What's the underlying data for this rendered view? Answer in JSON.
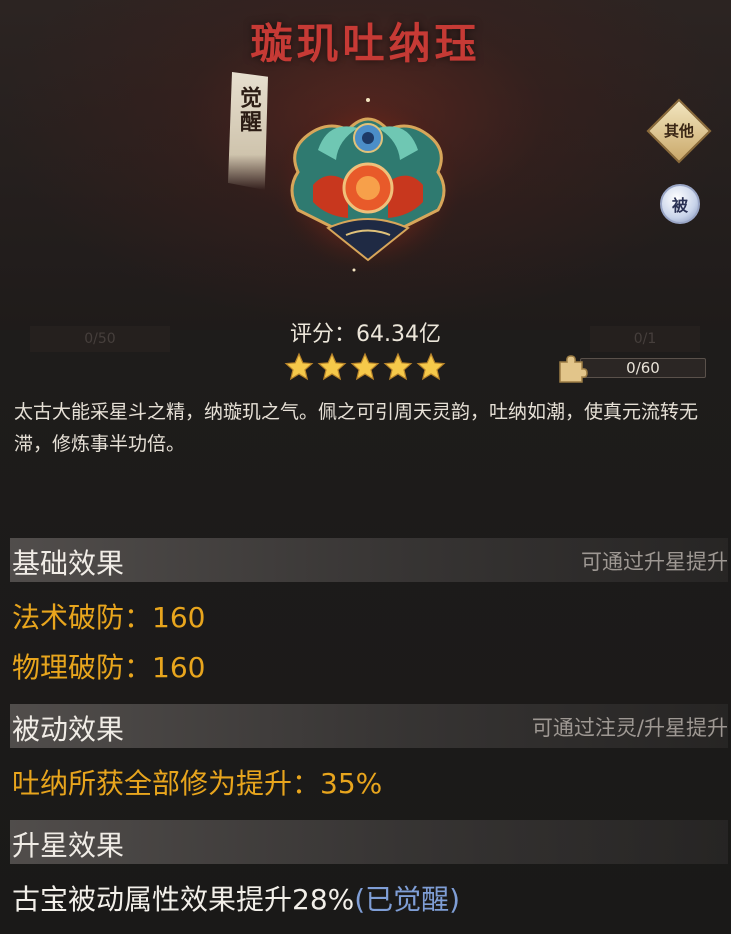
{
  "item": {
    "title": "璇玑吐纳珏",
    "awaken_tag": "觉醒",
    "emblem_icon": "ornate-jade-pendant-icon"
  },
  "side_buttons": {
    "other_label": "其他",
    "passive_label": "被"
  },
  "score": {
    "text": "评分：64.34亿",
    "stars": 5
  },
  "fragment_progress": {
    "label": "0/60",
    "current": 0,
    "max": 60,
    "icon": "puzzle-piece-icon"
  },
  "background_ghost": {
    "left_label": "0/50",
    "right_label": "0/1"
  },
  "description": "太古大能采星斗之精，纳璇玑之气。佩之可引周天灵韵，吐纳如潮，使真元流转无滞，修炼事半功倍。",
  "base_effect": {
    "header": "基础效果",
    "hint": "可通过升星提升",
    "lines": [
      "法术破防：160",
      "物理破防：160"
    ]
  },
  "passive_effect": {
    "header": "被动效果",
    "hint": "可通过注灵/升星提升",
    "lines": [
      "吐纳所获全部修为提升：35%"
    ]
  },
  "star_effect": {
    "header": "升星效果",
    "line_main": "古宝被动属性效果提升28%",
    "line_status": "(已觉醒)"
  },
  "colors": {
    "title": "#c63a35",
    "effect_value": "#e8a51d",
    "awakened": "#7f9ed6",
    "star": "#f6c94a"
  }
}
